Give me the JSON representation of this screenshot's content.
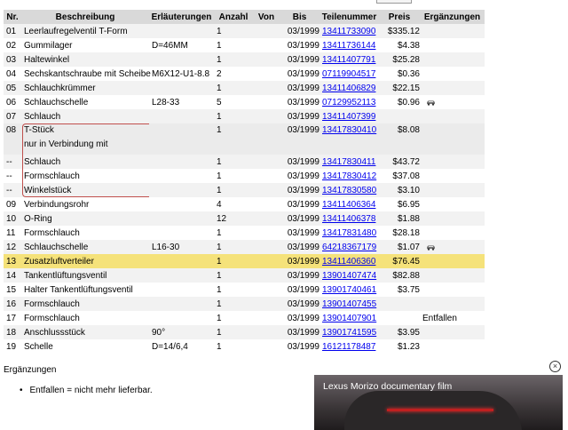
{
  "table": {
    "headers": [
      "Nr.",
      "Beschreibung",
      "Erläuterungen",
      "Anzahl",
      "Von",
      "Bis",
      "Teilenummer",
      "Preis",
      "Ergänzungen"
    ],
    "rows": [
      {
        "nr": "01",
        "beschreibung": "Leerlaufregelventil T-Form",
        "erl": "",
        "anzahl": "1",
        "von": "",
        "bis": "03/1999",
        "teil": "13411733090",
        "preis": "$335.12",
        "erg": ""
      },
      {
        "nr": "02",
        "beschreibung": "Gummilager",
        "erl": "D=46MM",
        "anzahl": "1",
        "von": "",
        "bis": "03/1999",
        "teil": "13411736144",
        "preis": "$4.38",
        "erg": ""
      },
      {
        "nr": "03",
        "beschreibung": "Haltewinkel",
        "erl": "",
        "anzahl": "1",
        "von": "",
        "bis": "03/1999",
        "teil": "13411407791",
        "preis": "$25.28",
        "erg": ""
      },
      {
        "nr": "04",
        "beschreibung": "Sechskantschraube mit Scheibe",
        "erl": "M6X12-U1-8.8",
        "anzahl": "2",
        "von": "",
        "bis": "03/1999",
        "teil": "07119904517",
        "preis": "$0.36",
        "erg": ""
      },
      {
        "nr": "05",
        "beschreibung": "Schlauchkrümmer",
        "erl": "",
        "anzahl": "1",
        "von": "",
        "bis": "03/1999",
        "teil": "13411406829",
        "preis": "$22.15",
        "erg": ""
      },
      {
        "nr": "06",
        "beschreibung": "Schlauchschelle",
        "erl": "L28-33",
        "anzahl": "5",
        "von": "",
        "bis": "03/1999",
        "teil": "07129952113",
        "preis": "$0.96",
        "erg": "",
        "icon": "car-icon"
      },
      {
        "nr": "07",
        "beschreibung": "Schlauch",
        "erl": "",
        "anzahl": "1",
        "von": "",
        "bis": "03/1999",
        "teil": "13411407399",
        "preis": "",
        "erg": ""
      },
      {
        "nr": "08",
        "beschreibung": "T-Stück",
        "beschreibung2": "nur in Verbindung mit",
        "erl": "",
        "anzahl": "1",
        "von": "",
        "bis": "03/1999",
        "teil": "13417830410",
        "preis": "$8.08",
        "erg": ""
      },
      {
        "nr": "--",
        "beschreibung": "Schlauch",
        "erl": "",
        "anzahl": "1",
        "von": "",
        "bis": "03/1999",
        "teil": "13417830411",
        "preis": "$43.72",
        "erg": ""
      },
      {
        "nr": "--",
        "beschreibung": "Formschlauch",
        "erl": "",
        "anzahl": "1",
        "von": "",
        "bis": "03/1999",
        "teil": "13417830412",
        "preis": "$37.08",
        "erg": ""
      },
      {
        "nr": "--",
        "beschreibung": "Winkelstück",
        "erl": "",
        "anzahl": "1",
        "von": "",
        "bis": "03/1999",
        "teil": "13417830580",
        "preis": "$3.10",
        "erg": ""
      },
      {
        "nr": "09",
        "beschreibung": "Verbindungsrohr",
        "erl": "",
        "anzahl": "4",
        "von": "",
        "bis": "03/1999",
        "teil": "13411406364",
        "preis": "$6.95",
        "erg": ""
      },
      {
        "nr": "10",
        "beschreibung": "O-Ring",
        "erl": "",
        "anzahl": "12",
        "von": "",
        "bis": "03/1999",
        "teil": "13411406378",
        "preis": "$1.88",
        "erg": ""
      },
      {
        "nr": "11",
        "beschreibung": "Formschlauch",
        "erl": "",
        "anzahl": "1",
        "von": "",
        "bis": "03/1999",
        "teil": "13417831480",
        "preis": "$28.18",
        "erg": ""
      },
      {
        "nr": "12",
        "beschreibung": "Schlauchschelle",
        "erl": "L16-30",
        "anzahl": "1",
        "von": "",
        "bis": "03/1999",
        "teil": "64218367179",
        "preis": "$1.07",
        "erg": "",
        "icon": "car-icon"
      },
      {
        "nr": "13",
        "beschreibung": "Zusatzluftverteiler",
        "erl": "",
        "anzahl": "1",
        "von": "",
        "bis": "03/1999",
        "teil": "13411406360",
        "preis": "$76.45",
        "erg": "",
        "highlight": true
      },
      {
        "nr": "14",
        "beschreibung": "Tankentlüftungsventil",
        "erl": "",
        "anzahl": "1",
        "von": "",
        "bis": "03/1999",
        "teil": "13901407474",
        "preis": "$82.88",
        "erg": ""
      },
      {
        "nr": "15",
        "beschreibung": "Halter Tankentlüftungsventil",
        "erl": "",
        "anzahl": "1",
        "von": "",
        "bis": "03/1999",
        "teil": "13901740461",
        "preis": "$3.75",
        "erg": ""
      },
      {
        "nr": "16",
        "beschreibung": "Formschlauch",
        "erl": "",
        "anzahl": "1",
        "von": "",
        "bis": "03/1999",
        "teil": "13901407455",
        "preis": "",
        "erg": ""
      },
      {
        "nr": "17",
        "beschreibung": "Formschlauch",
        "erl": "",
        "anzahl": "1",
        "von": "",
        "bis": "03/1999",
        "teil": "13901407901",
        "preis": "",
        "erg": "Entfallen"
      },
      {
        "nr": "18",
        "beschreibung": "Anschlussstück",
        "erl": "90°",
        "anzahl": "1",
        "von": "",
        "bis": "03/1999",
        "teil": "13901741595",
        "preis": "$3.95",
        "erg": ""
      },
      {
        "nr": "19",
        "beschreibung": "Schelle",
        "erl": "D=14/6,4",
        "anzahl": "1",
        "von": "",
        "bis": "03/1999",
        "teil": "16121178487",
        "preis": "$1.23",
        "erg": ""
      }
    ]
  },
  "ergaenzungen": {
    "title": "Ergänzungen",
    "items": [
      "Entfallen = nicht mehr lieferbar."
    ]
  },
  "video": {
    "title": "Lexus Morizo documentary film"
  },
  "colors": {
    "header_bg": "#d9d9d9",
    "highlight": "#f5e27a",
    "link": "#0000ee",
    "bracket": "#c0504d"
  }
}
